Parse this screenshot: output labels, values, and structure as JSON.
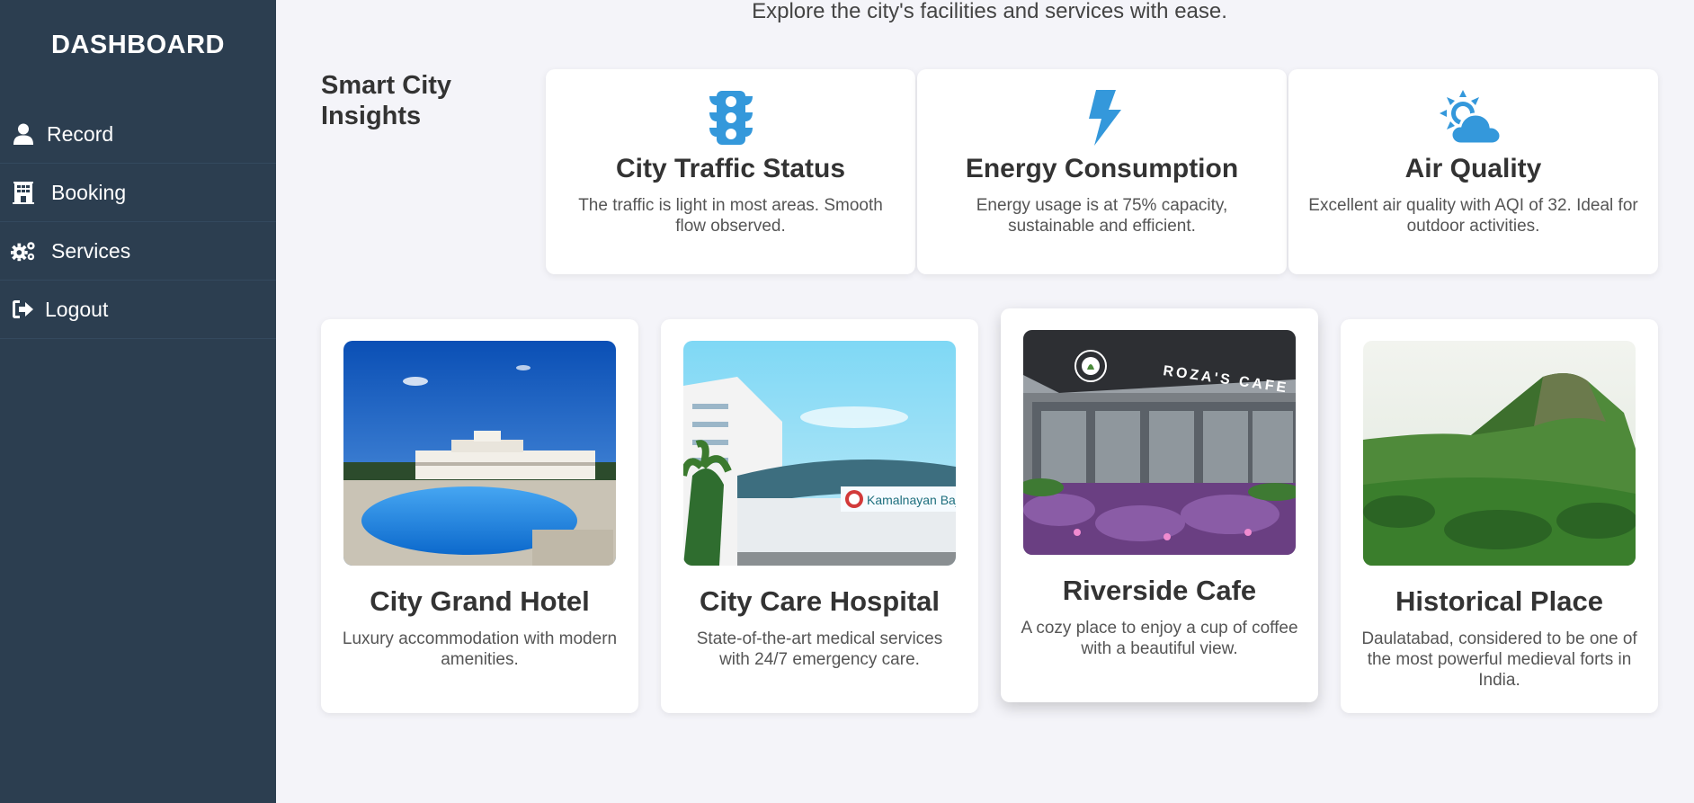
{
  "sidebar": {
    "title": "DASHBOARD",
    "items": [
      {
        "label": "Record",
        "icon": "user-icon"
      },
      {
        "label": "Booking",
        "icon": "building-icon"
      },
      {
        "label": "Services",
        "icon": "gears-icon"
      },
      {
        "label": "Logout",
        "icon": "sign-out-icon"
      }
    ]
  },
  "main": {
    "subtitle": "Explore the city's facilities and services with ease.",
    "insights_title": "Smart City Insights",
    "insights": [
      {
        "title": "City Traffic Status",
        "text": "The traffic is light in most areas. Smooth flow observed.",
        "icon": "traffic-light-icon"
      },
      {
        "title": "Energy Consumption",
        "text": "Energy usage is at 75% capacity, sustainable and efficient.",
        "icon": "bolt-icon"
      },
      {
        "title": "Air Quality",
        "text": "Excellent air quality with AQI of 32. Ideal for outdoor activities.",
        "icon": "cloud-sun-icon"
      }
    ],
    "places": [
      {
        "title": "City Grand Hotel",
        "text": "Luxury accommodation with modern amenities."
      },
      {
        "title": "City Care Hospital",
        "text": "State-of-the-art medical services with 24/7 emergency care.",
        "sign": "Kamalnayan Bajaj H"
      },
      {
        "title": "Riverside Cafe",
        "text": "A cozy place to enjoy a cup of coffee with a beautiful view.",
        "sign": "ROZA'S CAFE"
      },
      {
        "title": "Historical Place",
        "text": "Daulatabad, considered to be one of the most powerful medieval forts in India."
      }
    ]
  },
  "colors": {
    "sidebar": "#2c3e50",
    "accent": "#3498db",
    "background": "#f4f4f9"
  }
}
